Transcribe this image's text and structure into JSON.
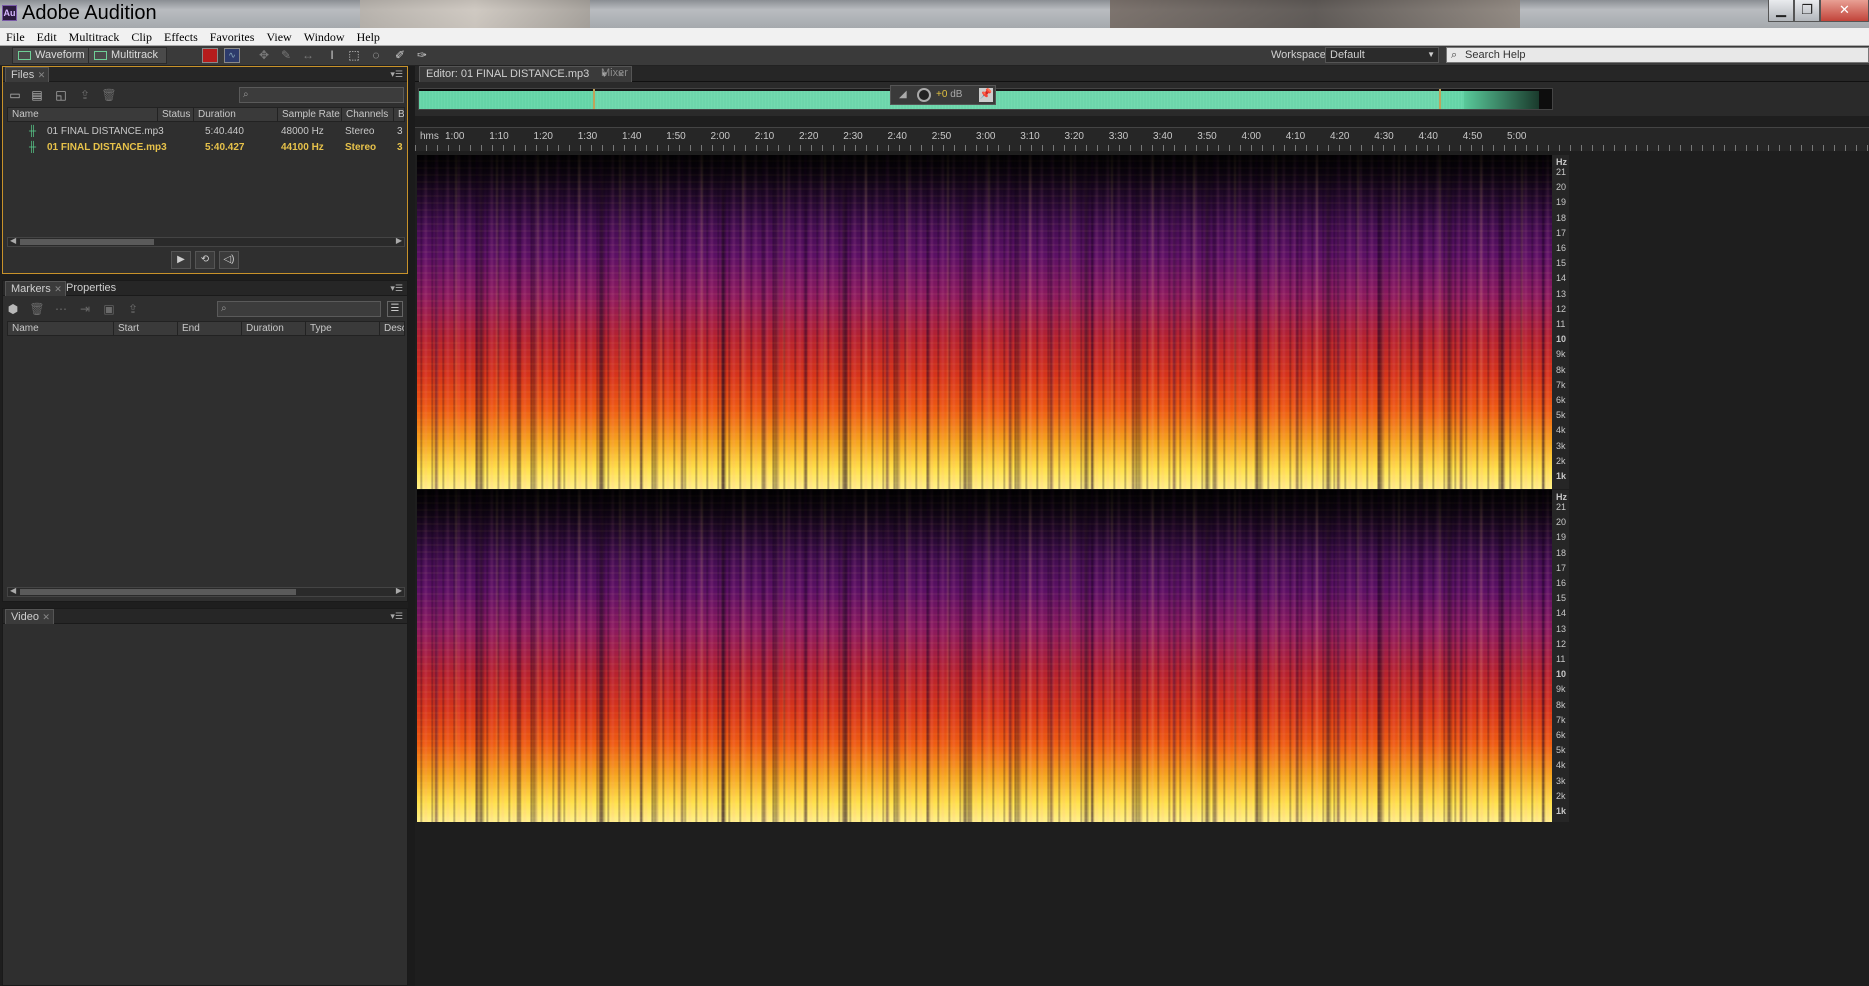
{
  "window": {
    "title": "Adobe Audition",
    "logo_text": "Au",
    "minimize": "▁",
    "maximize": "❐",
    "close": "✕"
  },
  "menu": [
    "File",
    "Edit",
    "Multitrack",
    "Clip",
    "Effects",
    "Favorites",
    "View",
    "Window",
    "Help"
  ],
  "toolbar": {
    "waveform_label": "Waveform",
    "multitrack_label": "Multitrack",
    "workspace_label": "Workspace:",
    "workspace_value": "Default",
    "search_placeholder": "Search Help"
  },
  "files_panel": {
    "tab": "Files",
    "columns": [
      "Name",
      "Status",
      "Duration",
      "Sample Rate",
      "Channels",
      "Bi"
    ],
    "rows": [
      {
        "name": "01 FINAL DISTANCE.mp3",
        "status": "",
        "duration": "5:40.440",
        "sample_rate": "48000 Hz",
        "channels": "Stereo",
        "bits": "3",
        "selected": false
      },
      {
        "name": "01 FINAL DISTANCE.mp3",
        "status": "",
        "duration": "5:40.427",
        "sample_rate": "44100 Hz",
        "channels": "Stereo",
        "bits": "3",
        "selected": true
      }
    ]
  },
  "markers_panel": {
    "tabs": [
      "Markers",
      "Properties"
    ],
    "columns": [
      "Name",
      "Start",
      "End",
      "Duration",
      "Type",
      "Descr"
    ]
  },
  "video_panel": {
    "tab": "Video"
  },
  "editor": {
    "tab": "Editor: 01 FINAL DISTANCE.mp3",
    "mixer_tab": "Mixer",
    "hud_gain": "+0",
    "hud_unit": "dB",
    "ruler_unit": "hms",
    "ruler_labels": [
      "1:00",
      "1:10",
      "1:20",
      "1:30",
      "1:40",
      "1:50",
      "2:00",
      "2:10",
      "2:20",
      "2:30",
      "2:40",
      "2:50",
      "3:00",
      "3:10",
      "3:20",
      "3:30",
      "3:40",
      "3:50",
      "4:00",
      "4:10",
      "4:20",
      "4:30",
      "4:40",
      "4:50",
      "5:00"
    ],
    "hz_unit": "Hz",
    "hz_labels": [
      "21",
      "20",
      "19",
      "18",
      "17",
      "16",
      "15",
      "14",
      "13",
      "12",
      "11",
      "10",
      "9k",
      "8k",
      "7k",
      "6k",
      "5k",
      "4k",
      "3k",
      "2k",
      "1k"
    ]
  },
  "colors": {
    "waveform_green": "#6fe0b4",
    "selected_file": "#e7c24a",
    "spectrum_low": "#ffe04a",
    "spectrum_mid": "#d6341a",
    "spectrum_high": "#3a0c4a"
  }
}
